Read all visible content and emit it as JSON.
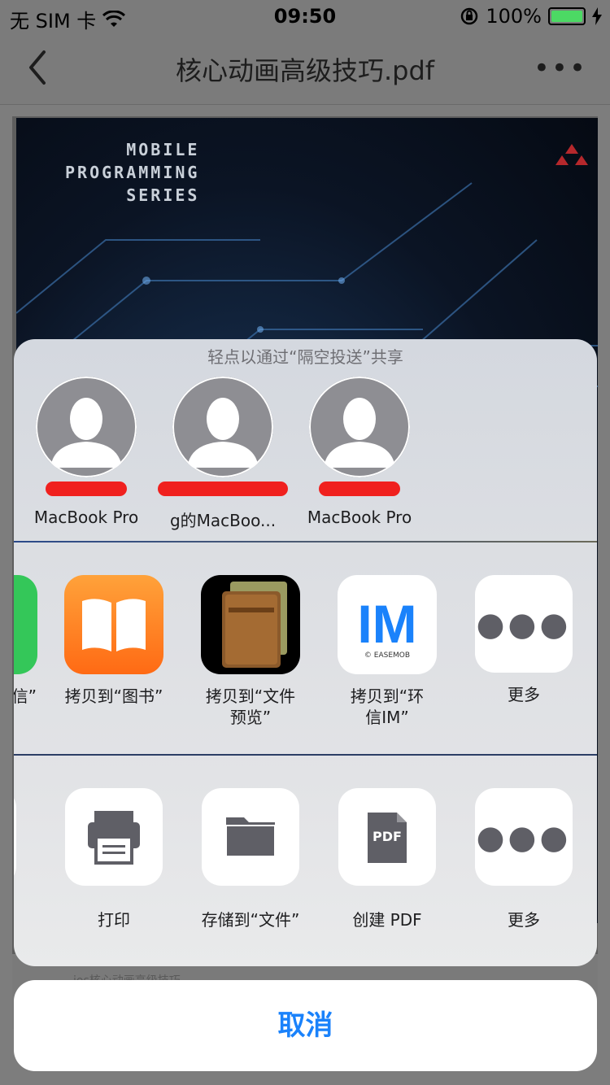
{
  "status_bar": {
    "carrier": "无 SIM 卡",
    "time": "09:50",
    "battery": "100%",
    "wifi_icon": "wifi-icon",
    "lock_icon": "rotation-lock-icon",
    "charging_icon": "charging-bolt-icon"
  },
  "nav": {
    "title": "核心动画高级技巧.pdf",
    "back_icon": "chevron-left-icon",
    "more_icon": "ellipsis-icon"
  },
  "pdf": {
    "cover_series": [
      "MOBILE",
      "PROGRAMMING",
      "SERIES"
    ],
    "footer_text": "ios核心动画高级技巧"
  },
  "share_sheet": {
    "airdrop_title": "轻点以通过“隔空投送”共享",
    "contacts": [
      {
        "name": "MacBook Pro"
      },
      {
        "name": "g的MacBoo..."
      },
      {
        "name": "MacBook Pro"
      }
    ],
    "apps": [
      {
        "label": "信”",
        "icon": "messages-icon",
        "color": "#34c759"
      },
      {
        "label": "拷贝到“图书”",
        "icon": "books-icon",
        "color": "#ff8a1f"
      },
      {
        "label": "拷贝到“文件预览”",
        "line1": "拷贝到“文件",
        "line2": "预览”",
        "icon": "file-viewer-icon",
        "color": "#000000"
      },
      {
        "label": "拷贝到“环信IM”",
        "line1": "拷贝到“环",
        "line2": "信IM”",
        "icon": "easemob-im-icon",
        "icon_text": "IM",
        "icon_subtext": "© EASEMOB",
        "color": "#1a82fb"
      },
      {
        "label": "更多",
        "icon": "more-icon"
      }
    ],
    "actions": [
      {
        "label": "打印",
        "icon": "printer-icon"
      },
      {
        "label": "存储到“文件”",
        "icon": "folder-icon"
      },
      {
        "label": "创建 PDF",
        "icon": "pdf-icon",
        "icon_text": "PDF"
      },
      {
        "label": "更多",
        "icon": "more-icon"
      }
    ],
    "cancel": "取消"
  }
}
